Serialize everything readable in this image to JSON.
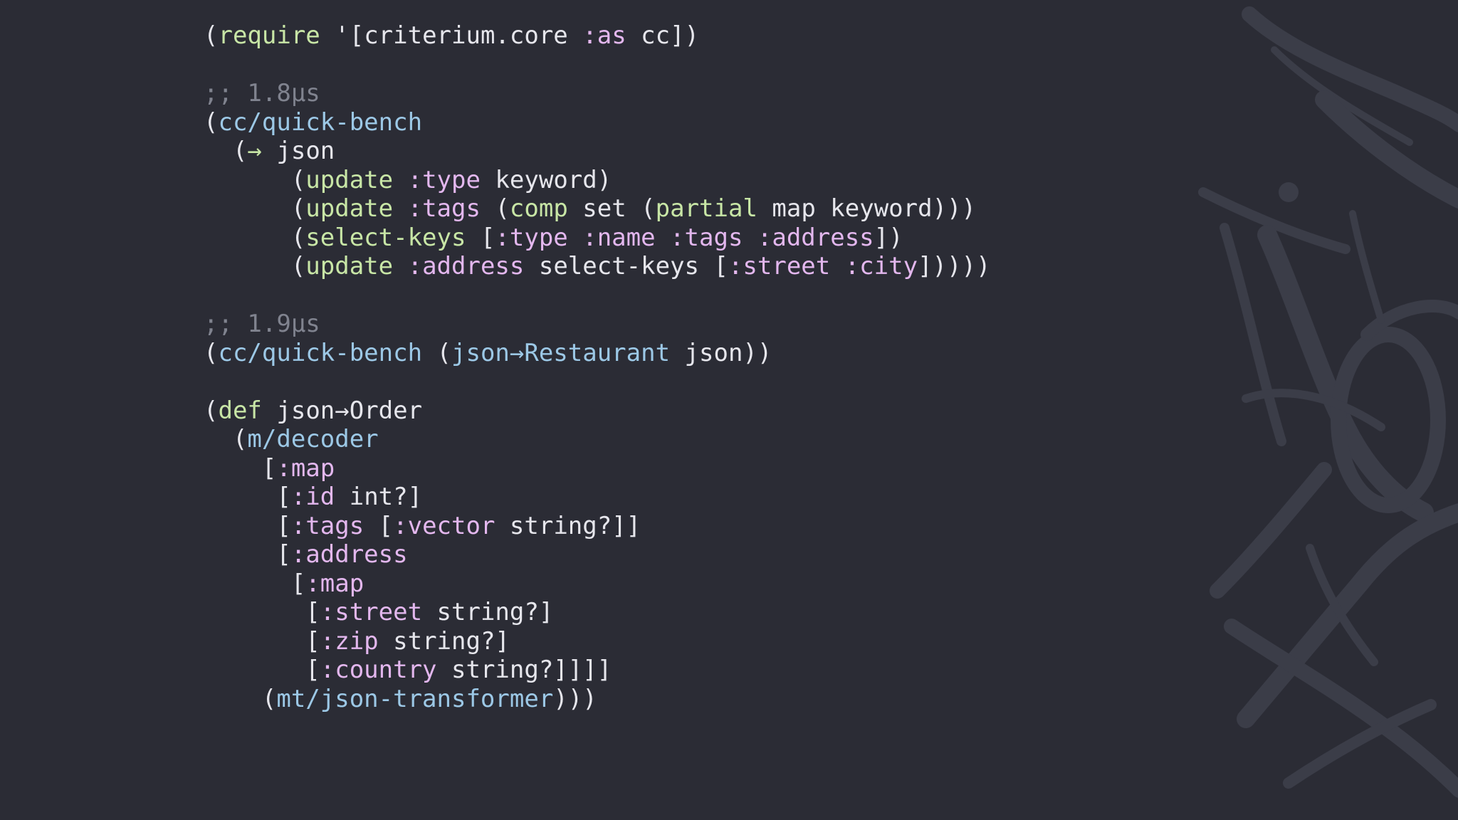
{
  "colors": {
    "background": "#2b2c35",
    "plain": "#e6e6ec",
    "function": "#c8e6a6",
    "namespaced": "#9cc8e6",
    "keyword": "#e3b7ee",
    "comment": "#80838f",
    "watermark": "#3d3f4a"
  },
  "watermark": {
    "icon": "brush-lettering-logo"
  },
  "code_lines": [
    [
      [
        "p",
        "("
      ],
      [
        "f",
        "require"
      ],
      [
        "p",
        " '[criterium.core "
      ],
      [
        "k",
        ":as"
      ],
      [
        "p",
        " cc])"
      ]
    ],
    [],
    [
      [
        "c",
        ";; 1.8µs"
      ]
    ],
    [
      [
        "p",
        "("
      ],
      [
        "n",
        "cc/quick-bench"
      ]
    ],
    [
      [
        "p",
        "  ("
      ],
      [
        "f",
        "→"
      ],
      [
        "p",
        " json"
      ]
    ],
    [
      [
        "p",
        "      ("
      ],
      [
        "f",
        "update"
      ],
      [
        "p",
        " "
      ],
      [
        "k",
        ":type"
      ],
      [
        "p",
        " keyword)"
      ]
    ],
    [
      [
        "p",
        "      ("
      ],
      [
        "f",
        "update"
      ],
      [
        "p",
        " "
      ],
      [
        "k",
        ":tags"
      ],
      [
        "p",
        " ("
      ],
      [
        "f",
        "comp"
      ],
      [
        "p",
        " set ("
      ],
      [
        "f",
        "partial"
      ],
      [
        "p",
        " map keyword)))"
      ]
    ],
    [
      [
        "p",
        "      ("
      ],
      [
        "f",
        "select-keys"
      ],
      [
        "p",
        " ["
      ],
      [
        "k",
        ":type :name :tags :address"
      ],
      [
        "p",
        "])"
      ]
    ],
    [
      [
        "p",
        "      ("
      ],
      [
        "f",
        "update"
      ],
      [
        "p",
        " "
      ],
      [
        "k",
        ":address"
      ],
      [
        "p",
        " select-keys ["
      ],
      [
        "k",
        ":street :city"
      ],
      [
        "p",
        "]))))"
      ]
    ],
    [],
    [
      [
        "c",
        ";; 1.9µs"
      ]
    ],
    [
      [
        "p",
        "("
      ],
      [
        "n",
        "cc/quick-bench"
      ],
      [
        "p",
        " ("
      ],
      [
        "n",
        "json→Restaurant"
      ],
      [
        "p",
        " json))"
      ]
    ],
    [],
    [
      [
        "p",
        "("
      ],
      [
        "f",
        "def"
      ],
      [
        "p",
        " json→Order"
      ]
    ],
    [
      [
        "p",
        "  ("
      ],
      [
        "n",
        "m/decoder"
      ]
    ],
    [
      [
        "p",
        "    ["
      ],
      [
        "k",
        ":map"
      ]
    ],
    [
      [
        "p",
        "     ["
      ],
      [
        "k",
        ":id"
      ],
      [
        "p",
        " int?]"
      ]
    ],
    [
      [
        "p",
        "     ["
      ],
      [
        "k",
        ":tags"
      ],
      [
        "p",
        " ["
      ],
      [
        "k",
        ":vector"
      ],
      [
        "p",
        " string?]]"
      ]
    ],
    [
      [
        "p",
        "     ["
      ],
      [
        "k",
        ":address"
      ]
    ],
    [
      [
        "p",
        "      ["
      ],
      [
        "k",
        ":map"
      ]
    ],
    [
      [
        "p",
        "       ["
      ],
      [
        "k",
        ":street"
      ],
      [
        "p",
        " string?]"
      ]
    ],
    [
      [
        "p",
        "       ["
      ],
      [
        "k",
        ":zip"
      ],
      [
        "p",
        " string?]"
      ]
    ],
    [
      [
        "p",
        "       ["
      ],
      [
        "k",
        ":country"
      ],
      [
        "p",
        " string?]]]]"
      ]
    ],
    [
      [
        "p",
        "    ("
      ],
      [
        "n",
        "mt/json-transformer"
      ],
      [
        "p",
        ")))"
      ]
    ]
  ]
}
